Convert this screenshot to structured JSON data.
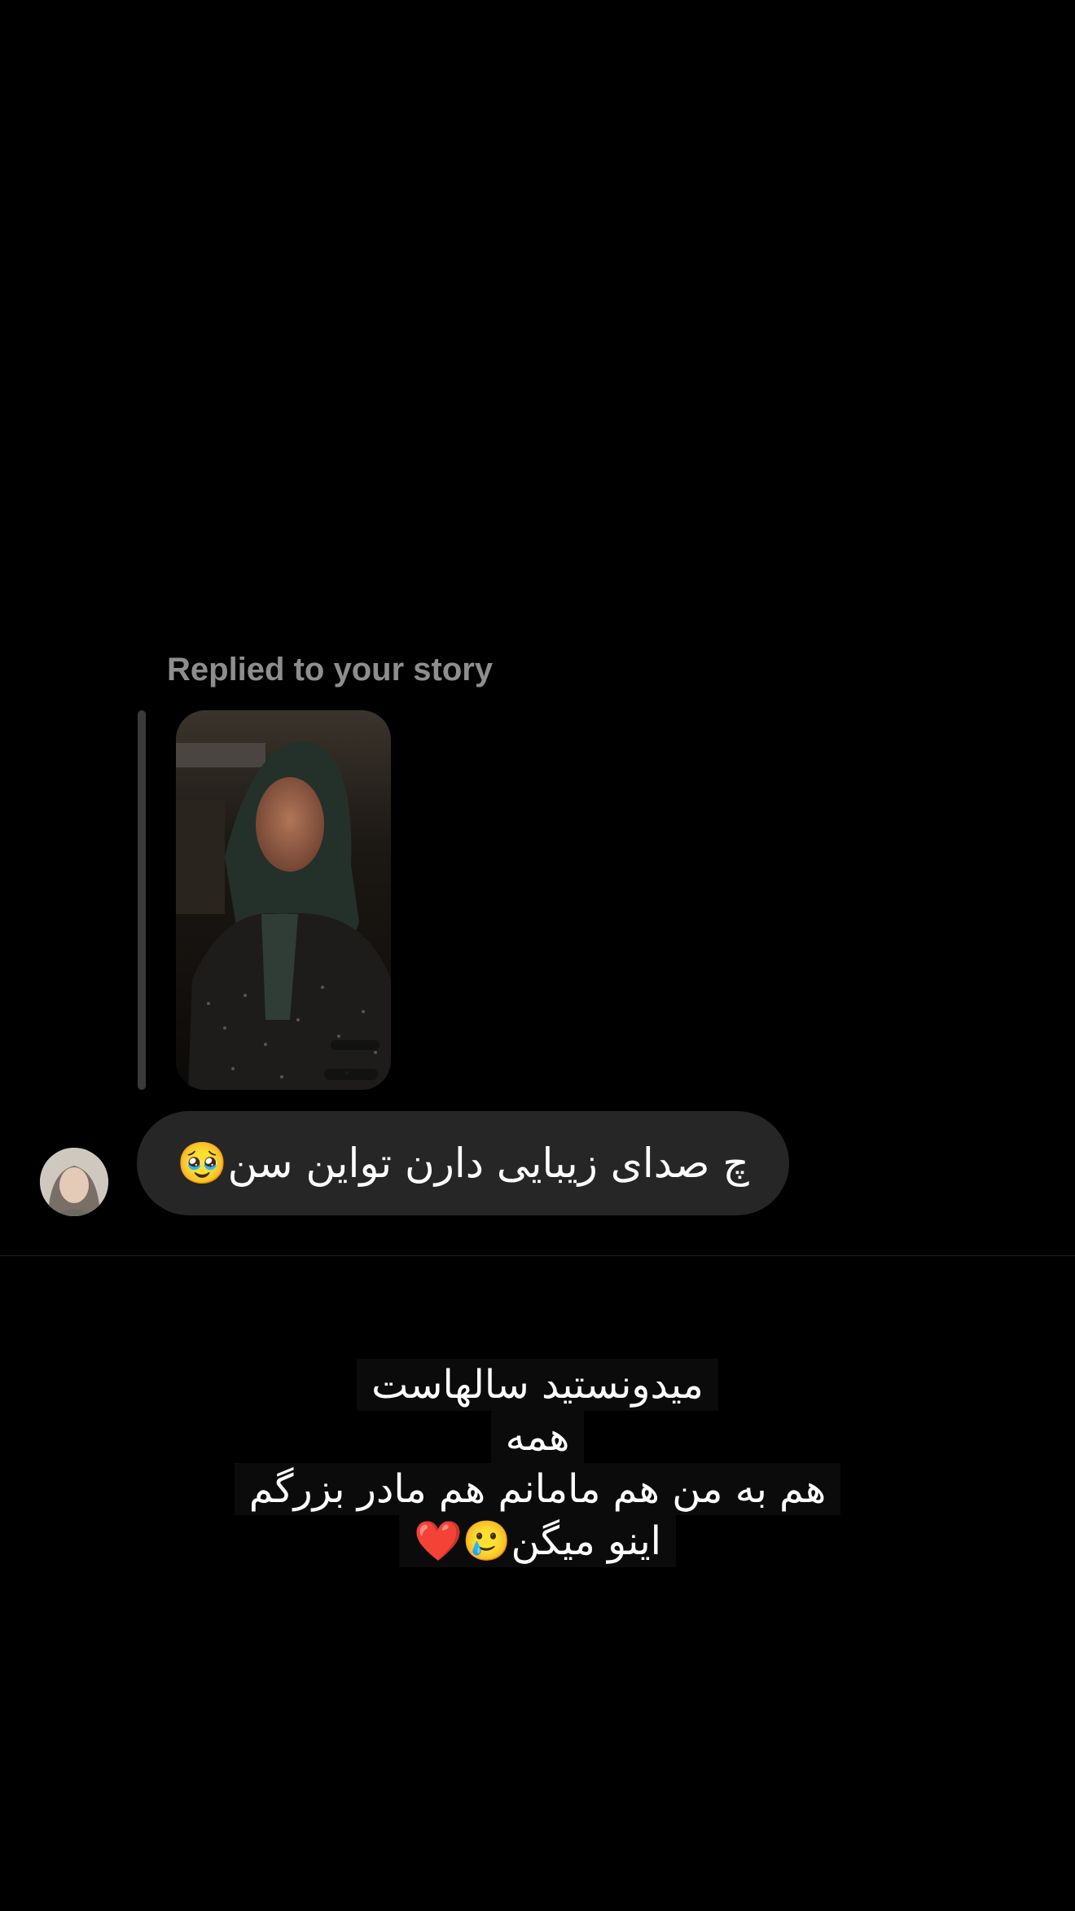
{
  "reply": {
    "label": "Replied to your story"
  },
  "message": {
    "text": "چ صدای زیبایی دارن تواین سن🥹"
  },
  "story_caption": {
    "lines": [
      "میدونستید سالهاست",
      "همه",
      "هم به من هم مامانم هم مادر بزرگم",
      "اینو میگن🥲❤️"
    ]
  },
  "colors": {
    "background": "#000000",
    "bubble": "#262626",
    "label": "#8e8e8e",
    "reply_bar": "#3a3a3a"
  }
}
